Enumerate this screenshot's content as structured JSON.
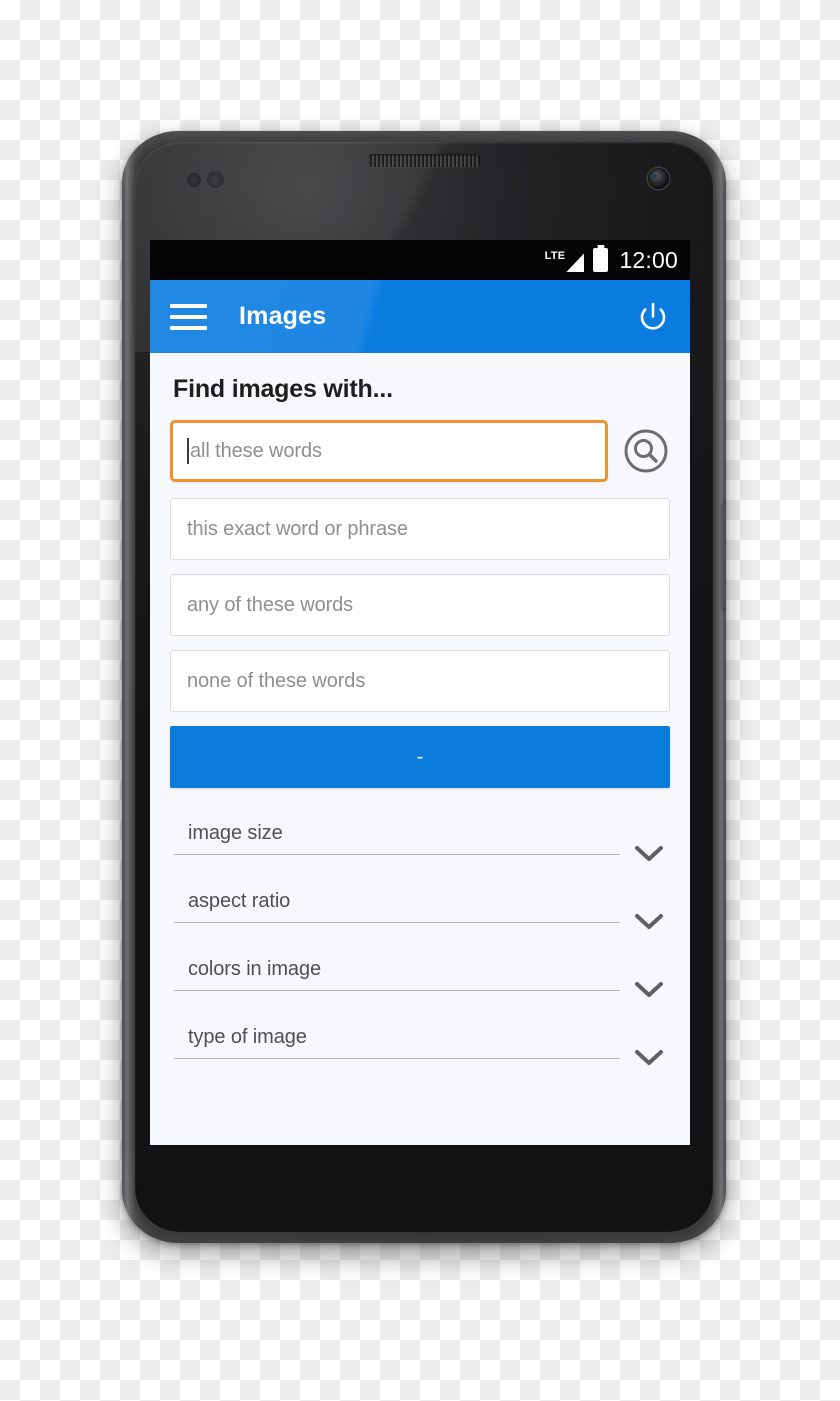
{
  "device": {
    "type": "android-smartphone-mockup",
    "orientation": "portrait"
  },
  "status_bar": {
    "network_label": "LTE",
    "signal_icon": "signal-triangle-icon",
    "battery_icon": "battery-full-icon",
    "time": "12:00"
  },
  "app_bar": {
    "menu_icon": "hamburger-menu-icon",
    "title": "Images",
    "power_icon": "power-icon",
    "background_color": "#0a7ce0"
  },
  "main": {
    "heading": "Find images with...",
    "search_icon": "search-icon",
    "fields": [
      {
        "name": "all-these-words",
        "placeholder": "all these words",
        "value": "",
        "focused": true,
        "focus_color": "#f2922c"
      },
      {
        "name": "this-exact-word-or-phrase",
        "placeholder": "this exact word or phrase",
        "value": "",
        "focused": false
      },
      {
        "name": "any-of-these-words",
        "placeholder": "any of these words",
        "value": "",
        "focused": false
      },
      {
        "name": "none-of-these-words",
        "placeholder": "none of these words",
        "value": "",
        "focused": false
      }
    ],
    "submit_button": {
      "label": "-",
      "color": "#0c7cdc"
    },
    "filters": [
      {
        "name": "image-size",
        "label": "image size",
        "icon": "chevron-down-icon"
      },
      {
        "name": "aspect-ratio",
        "label": "aspect ratio",
        "icon": "chevron-down-icon"
      },
      {
        "name": "colors-in-image",
        "label": "colors in image",
        "icon": "chevron-down-icon"
      },
      {
        "name": "type-of-image",
        "label": "type of image",
        "icon": "chevron-down-icon"
      }
    ]
  }
}
